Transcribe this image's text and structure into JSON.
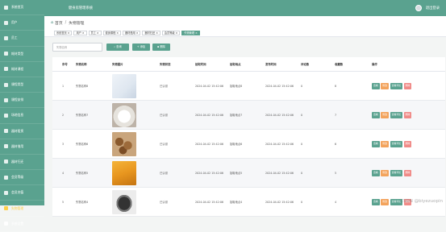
{
  "sidebar": {
    "items": [
      {
        "label": "系统首页",
        "icon": "home-icon"
      },
      {
        "label": "用户",
        "icon": "user-icon"
      },
      {
        "label": "员工",
        "icon": "staff-icon"
      },
      {
        "label": "耗材类型",
        "icon": "tag-icon"
      },
      {
        "label": "耗材课程",
        "icon": "book-icon"
      },
      {
        "label": "课程类型",
        "icon": "list-icon"
      },
      {
        "label": "课程安排",
        "icon": "calendar-icon"
      },
      {
        "label": "场地信息",
        "icon": "building-icon"
      },
      {
        "label": "器材租赁",
        "icon": "box-icon"
      },
      {
        "label": "器材借用",
        "icon": "share-icon"
      },
      {
        "label": "器材归还",
        "icon": "return-icon"
      },
      {
        "label": "会员等级",
        "icon": "star-icon"
      },
      {
        "label": "会员充值",
        "icon": "wallet-icon"
      },
      {
        "label": "失物管理",
        "icon": "search-icon"
      },
      {
        "label": "系统设置",
        "icon": "gear-icon"
      }
    ],
    "active_index": 13
  },
  "header": {
    "title": "健身房管理系统",
    "logout": "退出登录"
  },
  "breadcrumb": {
    "home": "首页",
    "separator": "/",
    "current": "失物管理"
  },
  "tags": [
    "系统首页 ×",
    "用户 ×",
    "员工 ×",
    "健身课程 ×",
    "器材借用 ×",
    "器材归还 ×",
    "会员等级 ×",
    "失物管理 ×"
  ],
  "toolbar": {
    "search_placeholder": "失物名称",
    "search_label": "查询",
    "add_label": "添加",
    "delete_label": "删除"
  },
  "table": {
    "headers": [
      "序号",
      "失物名称",
      "失物图片",
      "失物状态",
      "拾取时间",
      "拾取地点",
      "发布时间",
      "评论数",
      "收藏数",
      "操作"
    ],
    "rows": [
      {
        "no": "1",
        "name": "失物名称8",
        "status": "已认领",
        "pick_time": "2024-04-02 15:42:06",
        "place": "拾取地点8",
        "pub_time": "2024-04-02 15:42:06",
        "comments": "0",
        "favs": "8",
        "img": "cream"
      },
      {
        "no": "2",
        "name": "失物名称7",
        "status": "已认领",
        "pick_time": "2024-04-02 15:42:06",
        "place": "拾取地点7",
        "pub_time": "2024-04-02 15:42:06",
        "comments": "0",
        "favs": "7",
        "img": "powder"
      },
      {
        "no": "3",
        "name": "失物名称6",
        "status": "已认领",
        "pick_time": "2024-04-02 15:42:06",
        "place": "拾取地点6",
        "pub_time": "2024-04-02 15:42:06",
        "comments": "0",
        "favs": "6",
        "img": "nuts"
      },
      {
        "no": "4",
        "name": "失物名称5",
        "status": "已认领",
        "pick_time": "2024-04-02 15:42:06",
        "place": "拾取地点5",
        "pub_time": "2024-04-02 15:42:06",
        "comments": "0",
        "favs": "5",
        "img": "mango"
      },
      {
        "no": "5",
        "name": "失物名称4",
        "status": "已认领",
        "pick_time": "2024-04-02 15:42:06",
        "place": "拾取地点4",
        "pub_time": "2024-04-02 15:42:06",
        "comments": "0",
        "favs": "4",
        "img": "gadget"
      }
    ],
    "actions": {
      "detail": "查看",
      "edit": "修改",
      "comment": "查看评论",
      "delete": "删除"
    }
  },
  "watermark": "CSDN @biyezuopin",
  "colors": {
    "primary": "#5aa28f",
    "orange": "#f3a35c",
    "red": "#f08a87",
    "active_menu": "#ffd04b"
  }
}
